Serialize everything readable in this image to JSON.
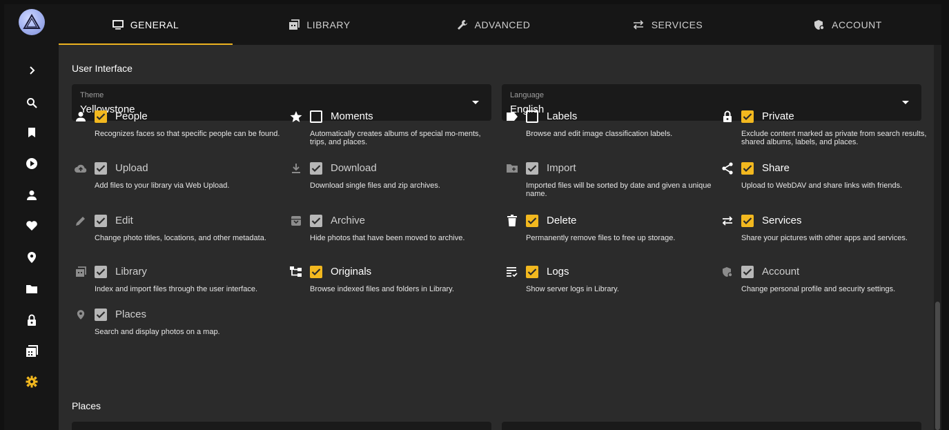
{
  "tabs": [
    {
      "label": "GENERAL",
      "icon": "monitor-icon"
    },
    {
      "label": "LIBRARY",
      "icon": "photo-library-icon"
    },
    {
      "label": "ADVANCED",
      "icon": "wrench-icon"
    },
    {
      "label": "SERVICES",
      "icon": "swap-icon"
    },
    {
      "label": "ACCOUNT",
      "icon": "shield-account-icon"
    }
  ],
  "sidebar": {
    "items": [
      "expand-icon",
      "search-icon",
      "bookmark-icon",
      "play-icon",
      "person-icon",
      "heart-icon",
      "location-icon",
      "folder-icon",
      "lock-icon",
      "library-icon",
      "settings-icon"
    ]
  },
  "user_interface": {
    "title": "User Interface",
    "theme": {
      "label": "Theme",
      "value": "Yellowstone"
    },
    "language": {
      "label": "Language",
      "value": "English"
    }
  },
  "features": [
    {
      "name": "People",
      "state": "on",
      "icon": "person-icon",
      "desc": "Recognizes faces so that specific people can be found."
    },
    {
      "name": "Moments",
      "state": "off",
      "icon": "star-icon",
      "desc": "Automatically creates albums of special mo-ments, trips, and places."
    },
    {
      "name": "Labels",
      "state": "off",
      "icon": "label-icon",
      "desc": "Browse and edit image classification labels."
    },
    {
      "name": "Private",
      "state": "on",
      "icon": "lock-icon",
      "desc": "Exclude content marked as private from search results, shared albums, labels, and places."
    },
    {
      "name": "Upload",
      "state": "grey",
      "icon": "cloud-upload-icon",
      "desc": "Add files to your library via Web Upload."
    },
    {
      "name": "Download",
      "state": "grey",
      "icon": "download-icon",
      "desc": "Download single files and zip archives."
    },
    {
      "name": "Import",
      "state": "grey",
      "icon": "folder-import-icon",
      "desc": "Imported files will be sorted by date and given a unique name."
    },
    {
      "name": "Share",
      "state": "on",
      "icon": "share-icon",
      "desc": "Upload to WebDAV and share links with friends."
    },
    {
      "name": "Edit",
      "state": "grey",
      "icon": "pencil-icon",
      "desc": "Change photo titles, locations, and other metadata."
    },
    {
      "name": "Archive",
      "state": "grey",
      "icon": "archive-icon",
      "desc": "Hide photos that have been moved to archive."
    },
    {
      "name": "Delete",
      "state": "on",
      "icon": "trash-icon",
      "desc": "Permanently remove files to free up storage."
    },
    {
      "name": "Services",
      "state": "on",
      "icon": "swap-icon",
      "desc": "Share your pictures with other apps and services."
    },
    {
      "name": "Library",
      "state": "grey",
      "icon": "photo-library-icon",
      "desc": "Index and import files through the user interface."
    },
    {
      "name": "Originals",
      "state": "on",
      "icon": "file-tree-icon",
      "desc": "Browse indexed files and folders in Library."
    },
    {
      "name": "Logs",
      "state": "on",
      "icon": "logs-icon",
      "desc": "Show server logs in Library."
    },
    {
      "name": "Account",
      "state": "grey",
      "icon": "shield-account-icon",
      "desc": "Change personal profile and security settings."
    },
    {
      "name": "Places",
      "state": "grey",
      "icon": "location-icon",
      "desc": "Search and display photos on a map."
    }
  ],
  "places": {
    "title": "Places"
  },
  "colors": {
    "accent": "#f2b81f",
    "background": "#2b2b2b",
    "sidebar": "#161616",
    "field": "#1a1a1a"
  }
}
